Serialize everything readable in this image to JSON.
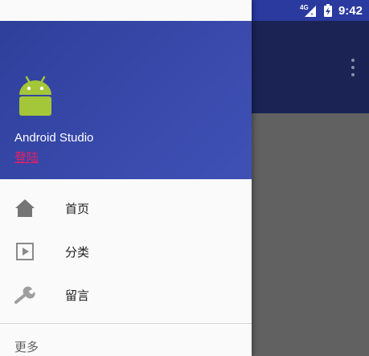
{
  "status_bar": {
    "network": "4G",
    "time": "9:42",
    "icons": [
      "signal-4g-icon",
      "battery-charging-icon"
    ]
  },
  "app": {
    "menu_icon": "overflow-menu-icon"
  },
  "drawer": {
    "header": {
      "logo": "android-logo",
      "title": "Android Studio",
      "login_label": "登陆"
    },
    "menu_items": [
      {
        "label": "首页",
        "icon": "home-icon"
      },
      {
        "label": "分类",
        "icon": "play-box-icon"
      },
      {
        "label": "留言",
        "icon": "wrench-icon"
      }
    ],
    "more_section_label": "更多"
  },
  "colors": {
    "status_bar": "#2a3a9e",
    "drawer_header": "#3949ab",
    "login_link": "#e91e63",
    "scrim_toolbar": "#1a2354",
    "scrim_body": "#616161"
  }
}
